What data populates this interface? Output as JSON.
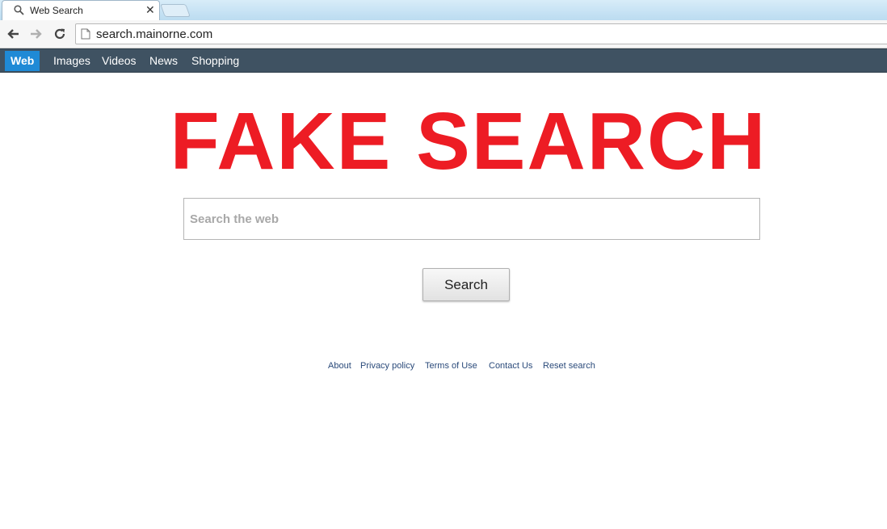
{
  "browser": {
    "tab_title": "Web Search",
    "tab_close": "✕",
    "url": "search.mainorne.com"
  },
  "nav": {
    "items": [
      "Web",
      "Images",
      "Videos",
      "News",
      "Shopping"
    ],
    "active": "Web"
  },
  "main": {
    "headline": "FAKE SEARCH",
    "headline_color": "#ed1c24",
    "search_placeholder": "Search the web",
    "search_button": "Search"
  },
  "footer": {
    "links": [
      "About",
      "Privacy policy",
      "Terms of Use",
      "Contact Us",
      "Reset search"
    ]
  },
  "colors": {
    "navbar": "#3f5262",
    "nav_active": "#1f8ad6"
  }
}
